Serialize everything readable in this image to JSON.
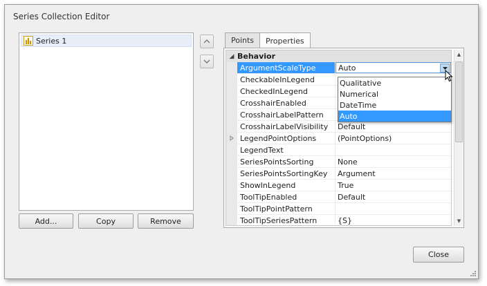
{
  "window": {
    "title": "Series Collection Editor"
  },
  "series_list": {
    "items": [
      {
        "label": "Series 1",
        "icon": "bar-chart-icon"
      }
    ]
  },
  "buttons": {
    "add": "Add...",
    "copy": "Copy",
    "remove": "Remove",
    "close": "Close"
  },
  "move_buttons": {
    "up_icon": "chevron-up-icon",
    "down_icon": "chevron-down-icon"
  },
  "tabs": [
    {
      "label": "Points",
      "active": false
    },
    {
      "label": "Properties",
      "active": true
    }
  ],
  "property_grid": {
    "category": "Behavior",
    "rows": [
      {
        "name": "ArgumentScaleType",
        "value": "Auto",
        "selected": true
      },
      {
        "name": "CheckableInLegend",
        "value": ""
      },
      {
        "name": "CheckedInLegend",
        "value": ""
      },
      {
        "name": "CrosshairEnabled",
        "value": ""
      },
      {
        "name": "CrosshairLabelPattern",
        "value": ""
      },
      {
        "name": "CrosshairLabelVisibility",
        "value": "Default"
      },
      {
        "name": "LegendPointOptions",
        "value": "(PointOptions)",
        "expandable": true
      },
      {
        "name": "LegendText",
        "value": ""
      },
      {
        "name": "SeriesPointsSorting",
        "value": "None"
      },
      {
        "name": "SeriesPointsSortingKey",
        "value": "Argument"
      },
      {
        "name": "ShowInLegend",
        "value": "True"
      },
      {
        "name": "ToolTipEnabled",
        "value": "Default"
      },
      {
        "name": "ToolTipPointPattern",
        "value": ""
      },
      {
        "name": "ToolTipSeriesPattern",
        "value": "{S}"
      }
    ]
  },
  "dropdown": {
    "options": [
      {
        "label": "Qualitative",
        "highlighted": false
      },
      {
        "label": "Numerical",
        "highlighted": false
      },
      {
        "label": "DateTime",
        "highlighted": false
      },
      {
        "label": "Auto",
        "highlighted": true
      }
    ]
  },
  "colors": {
    "selection": "#3399ff",
    "window_bg": "#efefef",
    "category_bg": "#e2e2e2"
  }
}
